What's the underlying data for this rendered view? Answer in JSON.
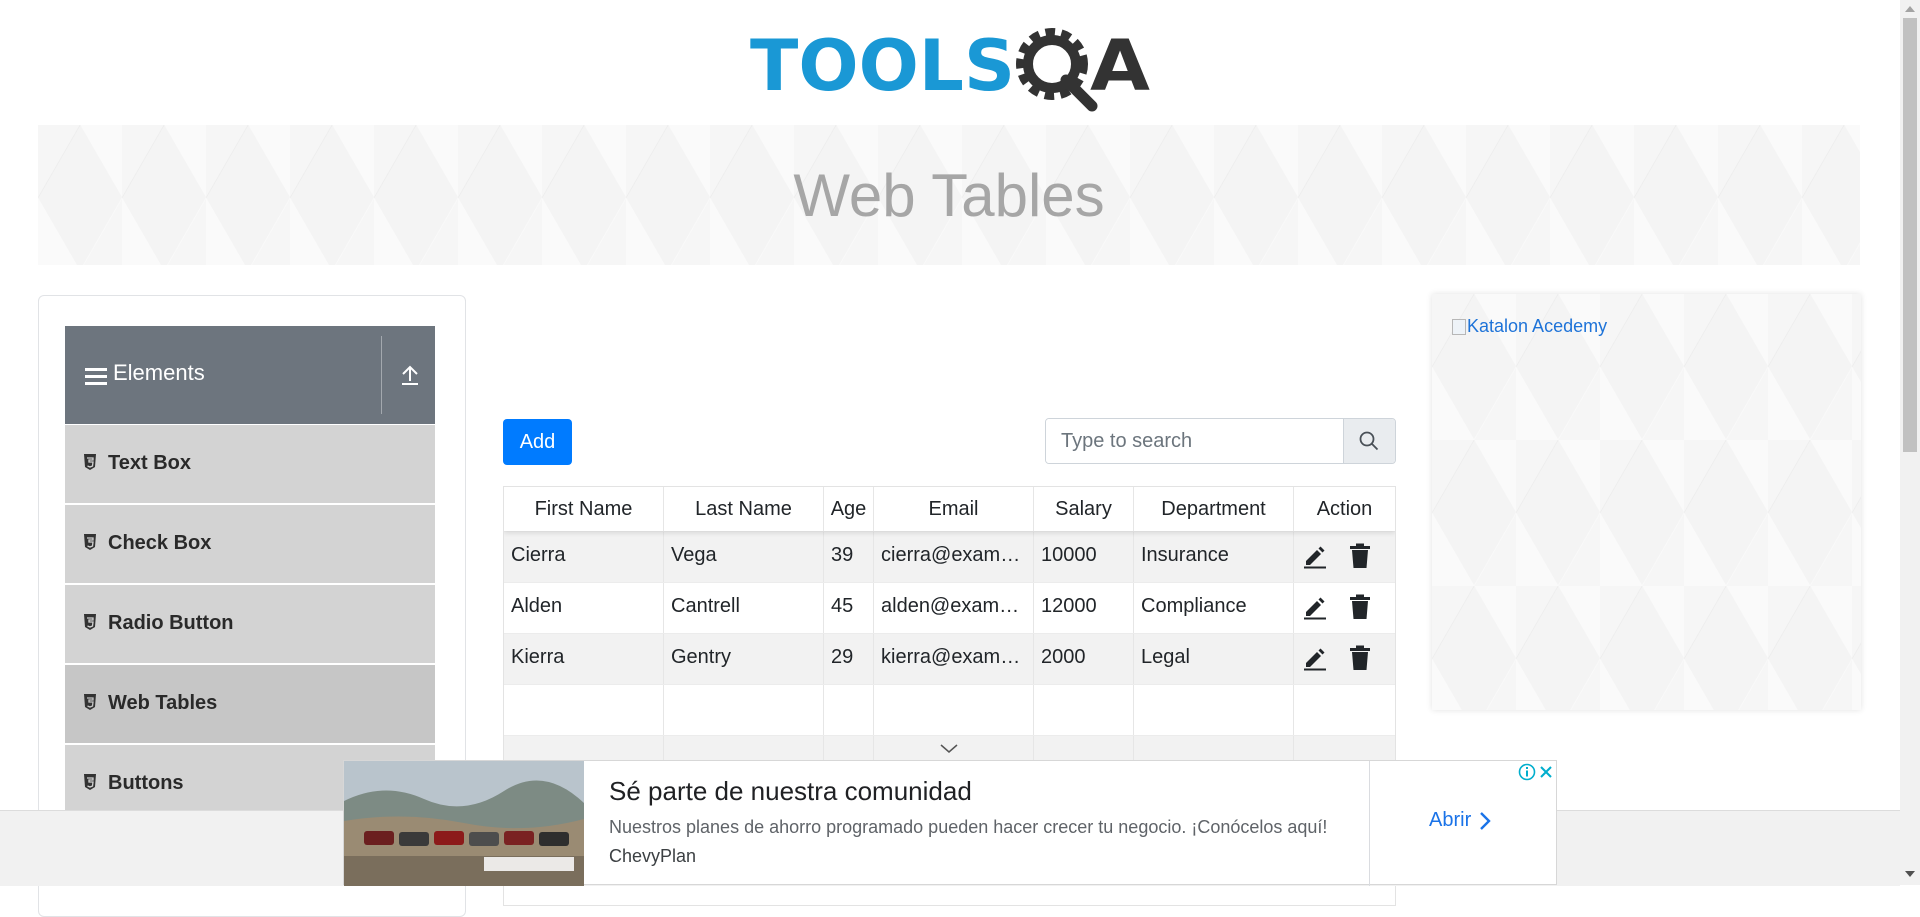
{
  "brand": {
    "logo_text_1": "TOOLS",
    "logo_text_2": "A",
    "primary_color": "#1a98d5",
    "secondary_color": "#333333"
  },
  "banner": {
    "title": "Web Tables"
  },
  "sidebar": {
    "group_title": "Elements",
    "header_color": "#6d757e",
    "items": [
      {
        "label": "Text Box",
        "active": false
      },
      {
        "label": "Check Box",
        "active": false
      },
      {
        "label": "Radio Button",
        "active": false
      },
      {
        "label": "Web Tables",
        "active": true
      },
      {
        "label": "Buttons",
        "active": false
      }
    ]
  },
  "toolbar": {
    "add_label": "Add",
    "add_color": "#007bff",
    "search_placeholder": "Type to search"
  },
  "table": {
    "headers": [
      "First Name",
      "Last Name",
      "Age",
      "Email",
      "Salary",
      "Department",
      "Action"
    ],
    "rows": [
      {
        "first_name": "Cierra",
        "last_name": "Vega",
        "age": "39",
        "email": "cierra@example.com",
        "salary": "10000",
        "department": "Insurance"
      },
      {
        "first_name": "Alden",
        "last_name": "Cantrell",
        "age": "45",
        "email": "alden@example.com",
        "salary": "12000",
        "department": "Compliance"
      },
      {
        "first_name": "Kierra",
        "last_name": "Gentry",
        "age": "29",
        "email": "kierra@example.com",
        "salary": "2000",
        "department": "Legal"
      }
    ]
  },
  "side_ad": {
    "alt_text": "Katalon Acedemy"
  },
  "bottom_ad": {
    "title": "Sé parte de nuestra comunidad",
    "description": "Nuestros planes de ahorro programado pueden hacer crecer tu negocio. ¡Conócelos aquí!",
    "source": "ChevyPlan",
    "cta": "Abrir",
    "cta_color": "#1a73e8"
  }
}
